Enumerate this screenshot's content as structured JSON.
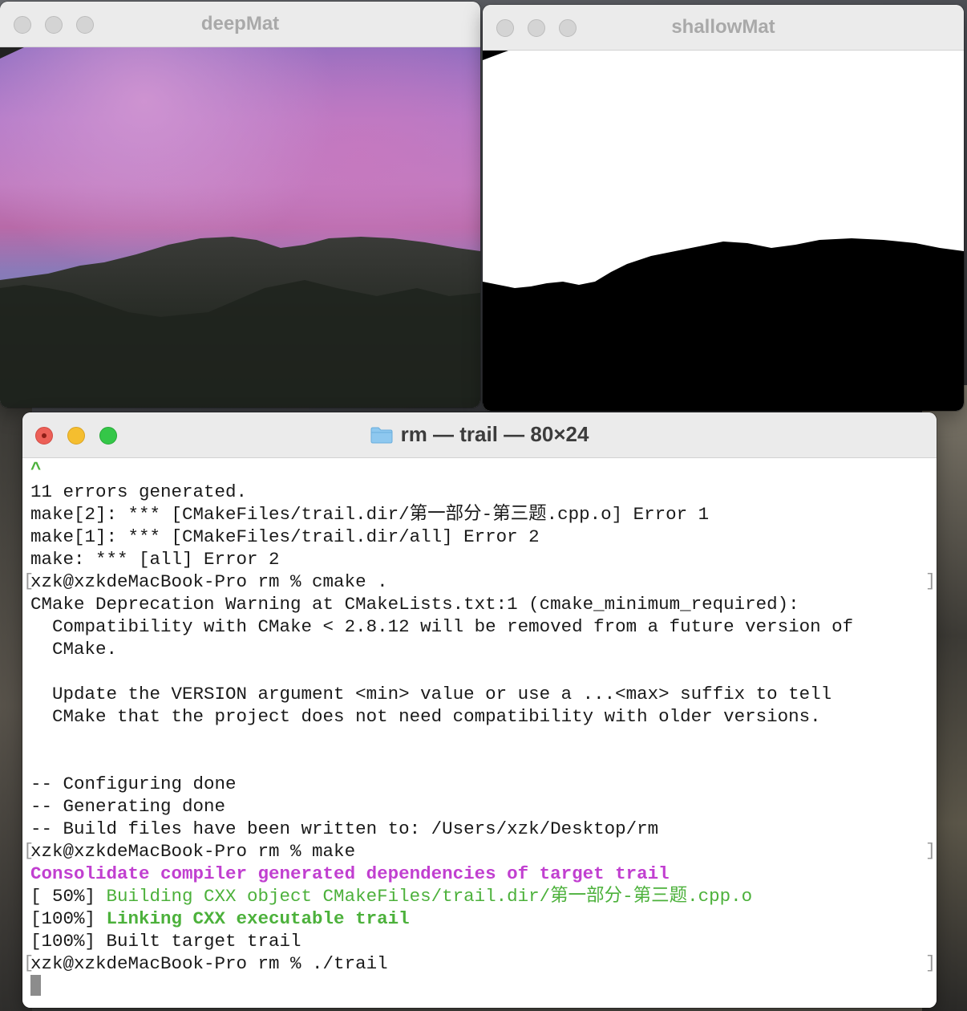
{
  "deep_window": {
    "title": "deepMat"
  },
  "shallow_window": {
    "title": "shallowMat"
  },
  "terminal": {
    "title": "rm — trail — 80×24",
    "lines": [
      {
        "text": "^",
        "style": "greenb",
        "mark": false
      },
      {
        "text": "11 errors generated.",
        "style": "",
        "mark": false
      },
      {
        "text": "make[2]: *** [CMakeFiles/trail.dir/第一部分-第三题.cpp.o] Error 1",
        "style": "",
        "mark": false
      },
      {
        "text": "make[1]: *** [CMakeFiles/trail.dir/all] Error 2",
        "style": "",
        "mark": false
      },
      {
        "text": "make: *** [all] Error 2",
        "style": "",
        "mark": false
      },
      {
        "text": "xzk@xzkdeMacBook-Pro rm % cmake .",
        "style": "",
        "mark": true
      },
      {
        "text": "CMake Deprecation Warning at CMakeLists.txt:1 (cmake_minimum_required):",
        "style": "",
        "mark": false
      },
      {
        "text": "  Compatibility with CMake < 2.8.12 will be removed from a future version of",
        "style": "",
        "mark": false
      },
      {
        "text": "  CMake.",
        "style": "",
        "mark": false
      },
      {
        "text": "",
        "style": "",
        "mark": false
      },
      {
        "text": "  Update the VERSION argument <min> value or use a ...<max> suffix to tell",
        "style": "",
        "mark": false
      },
      {
        "text": "  CMake that the project does not need compatibility with older versions.",
        "style": "",
        "mark": false
      },
      {
        "text": "",
        "style": "",
        "mark": false
      },
      {
        "text": "",
        "style": "",
        "mark": false
      },
      {
        "text": "-- Configuring done",
        "style": "",
        "mark": false
      },
      {
        "text": "-- Generating done",
        "style": "",
        "mark": false
      },
      {
        "text": "-- Build files have been written to: /Users/xzk/Desktop/rm",
        "style": "",
        "mark": false
      },
      {
        "text": "xzk@xzkdeMacBook-Pro rm % make",
        "style": "",
        "mark": true
      },
      {
        "text": "Consolidate compiler generated dependencies of target trail",
        "style": "mag",
        "mark": false
      },
      {
        "text": "[ 50%] ",
        "style": "",
        "mark": false,
        "rest": "Building CXX object CMakeFiles/trail.dir/第一部分-第三题.cpp.o",
        "rest_style": "green"
      },
      {
        "text": "[100%] ",
        "style": "",
        "mark": false,
        "rest": "Linking CXX executable trail",
        "rest_style": "greenb"
      },
      {
        "text": "[100%] Built target trail",
        "style": "",
        "mark": false
      },
      {
        "text": "xzk@xzkdeMacBook-Pro rm % ./trail",
        "style": "",
        "mark": true
      }
    ]
  },
  "colors": {
    "close": "#ec5f57",
    "minimize": "#f5be2f",
    "zoom": "#34c748",
    "green_text": "#4cb13b",
    "magenta_text": "#c13fd0"
  }
}
